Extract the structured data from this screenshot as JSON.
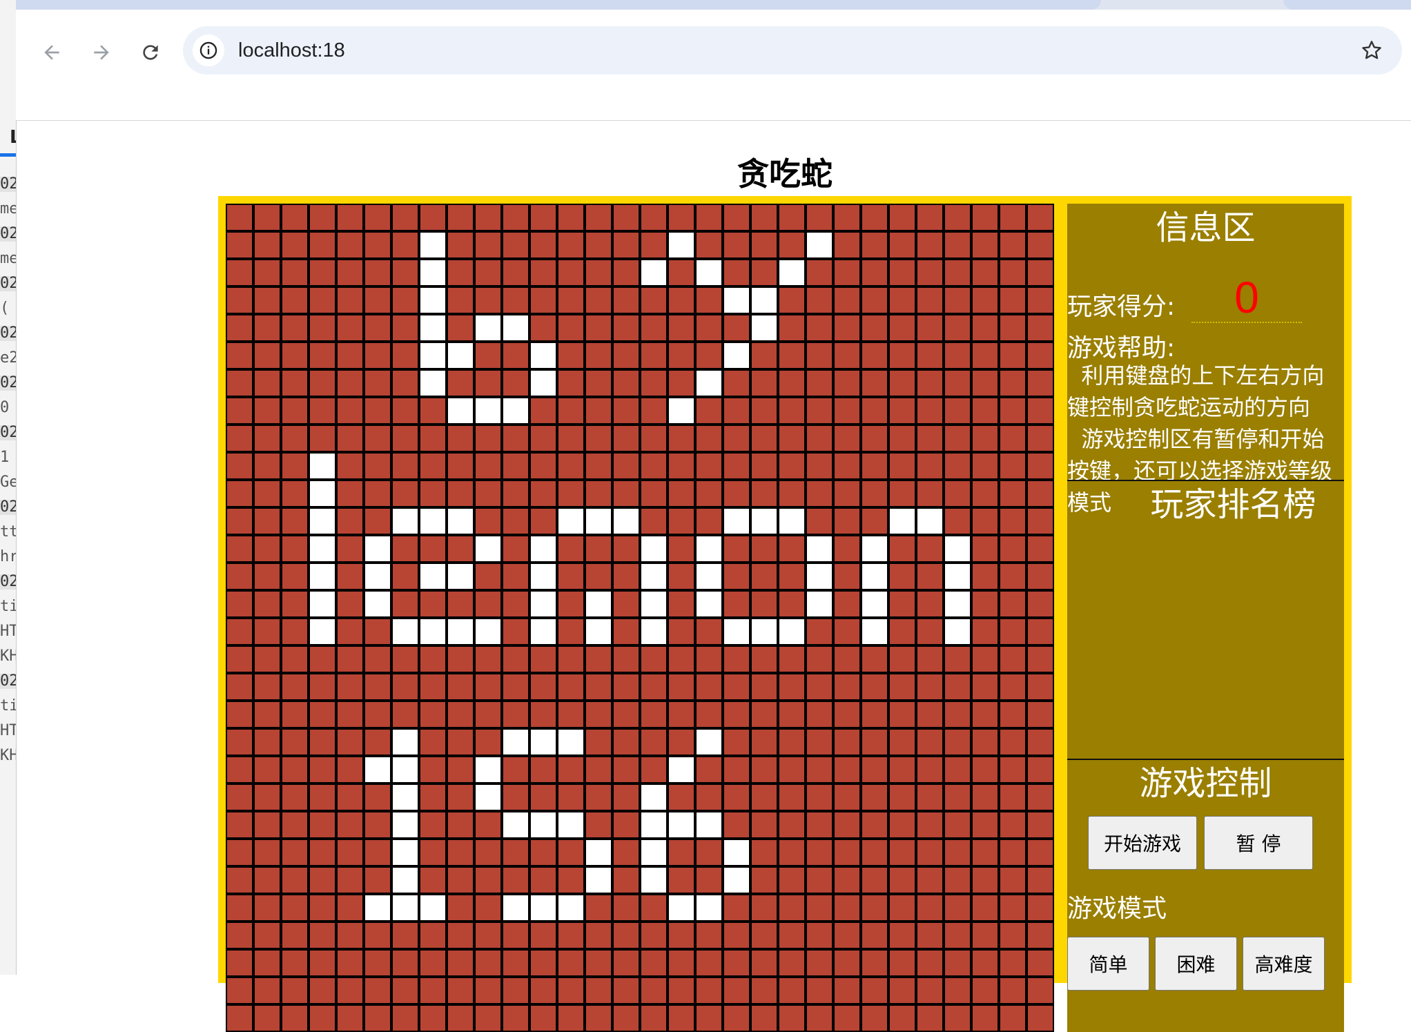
{
  "browser": {
    "url": "localhost:18",
    "icons": {
      "back": "arrow-left-icon",
      "forward": "arrow-right-icon",
      "reload": "reload-icon",
      "site_info": "info-icon",
      "bookmark": "star-icon"
    }
  },
  "devtools_fragments": [
    "02",
    "me",
    "02",
    "me",
    "02",
    "(",
    "02",
    "e2",
    "02",
    "0",
    "02",
    "1",
    "Ge",
    "02",
    "tt",
    "hr",
    "02",
    "ti",
    "HT",
    "KH",
    "02",
    "ti",
    "HT",
    "KH"
  ],
  "devtools_tab_letter": "L",
  "page": {
    "title": "贪吃蛇",
    "board": {
      "rows": 30,
      "cols": 30,
      "cell_color": "#b84434",
      "snake_color": "#ffffff",
      "white_cells": [
        [
          1,
          7
        ],
        [
          1,
          16
        ],
        [
          1,
          21
        ],
        [
          2,
          7
        ],
        [
          2,
          15
        ],
        [
          2,
          17
        ],
        [
          2,
          20
        ],
        [
          3,
          7
        ],
        [
          3,
          18
        ],
        [
          3,
          19
        ],
        [
          4,
          7
        ],
        [
          4,
          9
        ],
        [
          4,
          10
        ],
        [
          4,
          19
        ],
        [
          5,
          7
        ],
        [
          5,
          8
        ],
        [
          5,
          11
        ],
        [
          5,
          18
        ],
        [
          6,
          7
        ],
        [
          6,
          11
        ],
        [
          6,
          17
        ],
        [
          7,
          8
        ],
        [
          7,
          9
        ],
        [
          7,
          10
        ],
        [
          7,
          16
        ],
        [
          9,
          3
        ],
        [
          10,
          3
        ],
        [
          11,
          3
        ],
        [
          11,
          6
        ],
        [
          11,
          7
        ],
        [
          11,
          8
        ],
        [
          11,
          12
        ],
        [
          11,
          13
        ],
        [
          11,
          14
        ],
        [
          11,
          18
        ],
        [
          11,
          19
        ],
        [
          11,
          20
        ],
        [
          11,
          24
        ],
        [
          11,
          25
        ],
        [
          12,
          3
        ],
        [
          12,
          5
        ],
        [
          12,
          9
        ],
        [
          12,
          11
        ],
        [
          12,
          15
        ],
        [
          12,
          17
        ],
        [
          12,
          21
        ],
        [
          12,
          23
        ],
        [
          12,
          26
        ],
        [
          13,
          3
        ],
        [
          13,
          5
        ],
        [
          13,
          7
        ],
        [
          13,
          8
        ],
        [
          13,
          11
        ],
        [
          13,
          15
        ],
        [
          13,
          17
        ],
        [
          13,
          21
        ],
        [
          13,
          23
        ],
        [
          13,
          26
        ],
        [
          14,
          3
        ],
        [
          14,
          5
        ],
        [
          14,
          11
        ],
        [
          14,
          13
        ],
        [
          14,
          15
        ],
        [
          14,
          17
        ],
        [
          14,
          21
        ],
        [
          14,
          23
        ],
        [
          14,
          26
        ],
        [
          15,
          3
        ],
        [
          15,
          6
        ],
        [
          15,
          7
        ],
        [
          15,
          8
        ],
        [
          15,
          9
        ],
        [
          15,
          11
        ],
        [
          15,
          13
        ],
        [
          15,
          15
        ],
        [
          15,
          18
        ],
        [
          15,
          19
        ],
        [
          15,
          20
        ],
        [
          15,
          23
        ],
        [
          15,
          26
        ],
        [
          19,
          6
        ],
        [
          19,
          10
        ],
        [
          19,
          11
        ],
        [
          19,
          12
        ],
        [
          19,
          17
        ],
        [
          20,
          5
        ],
        [
          20,
          6
        ],
        [
          20,
          9
        ],
        [
          20,
          16
        ],
        [
          21,
          6
        ],
        [
          21,
          9
        ],
        [
          21,
          15
        ],
        [
          22,
          6
        ],
        [
          22,
          10
        ],
        [
          22,
          11
        ],
        [
          22,
          12
        ],
        [
          22,
          15
        ],
        [
          22,
          16
        ],
        [
          22,
          17
        ],
        [
          23,
          6
        ],
        [
          23,
          13
        ],
        [
          23,
          15
        ],
        [
          23,
          18
        ],
        [
          24,
          6
        ],
        [
          24,
          13
        ],
        [
          24,
          15
        ],
        [
          24,
          18
        ],
        [
          25,
          5
        ],
        [
          25,
          6
        ],
        [
          25,
          7
        ],
        [
          25,
          10
        ],
        [
          25,
          11
        ],
        [
          25,
          12
        ],
        [
          25,
          16
        ],
        [
          25,
          17
        ]
      ]
    },
    "info": {
      "title": "信息区",
      "score_label": "玩家得分:",
      "score_value": "0",
      "help_label": "游戏帮助:",
      "help_text": "  利用键盘的上下左右方向键控制贪吃蛇运动的方向\n  游戏控制区有暂停和开始按键，还可以选择游戏等级模式",
      "ranking_title": "玩家排名榜",
      "control_title": "游戏控制",
      "start_button": "开始游戏",
      "pause_button": "暂 停",
      "mode_label": "游戏模式",
      "mode_easy": "简单",
      "mode_hard": "困难",
      "mode_expert": "高难度"
    },
    "colors": {
      "frame": "#ffd700",
      "info_bg": "#9a7f00",
      "score": "#ff0000"
    }
  }
}
